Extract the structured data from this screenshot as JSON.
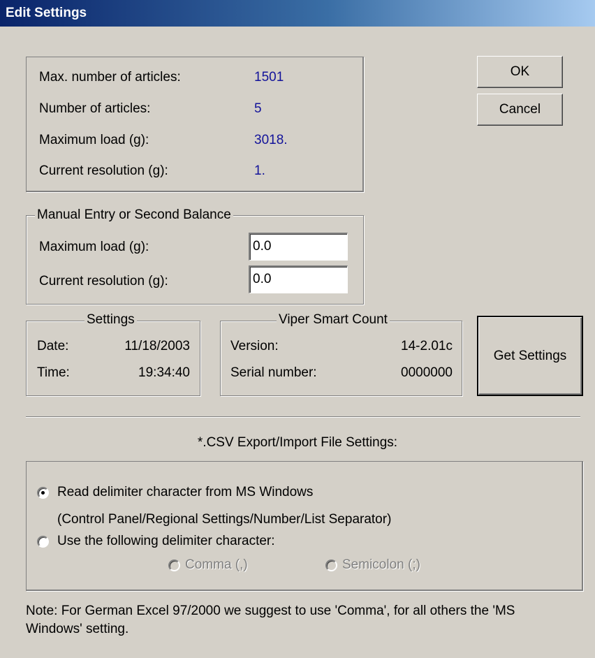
{
  "window": {
    "title": "Edit Settings"
  },
  "buttons": {
    "ok": "OK",
    "cancel": "Cancel",
    "get_settings": "Get Settings"
  },
  "info": {
    "max_articles_label": "Max. number of articles:",
    "max_articles_value": "1501",
    "num_articles_label": "Number of articles:",
    "num_articles_value": "5",
    "max_load_label": "Maximum load (g):",
    "max_load_value": "3018.",
    "resolution_label": "Current resolution (g):",
    "resolution_value": "1."
  },
  "manual": {
    "legend": "Manual Entry or Second Balance",
    "max_load_label": "Maximum load (g):",
    "max_load_value": "0.0",
    "resolution_label": "Current resolution (g):",
    "resolution_value": "0.0"
  },
  "settings": {
    "legend": "Settings",
    "date_label": "Date:",
    "date_value": "11/18/2003",
    "time_label": "Time:",
    "time_value": "19:34:40"
  },
  "viper": {
    "legend": "Viper Smart Count",
    "version_label": "Version:",
    "version_value": "14-2.01c",
    "serial_label": "Serial number:",
    "serial_value": "0000000"
  },
  "csv": {
    "heading": "*.CSV Export/Import File Settings:",
    "option_windows_line1": "Read delimiter character from MS Windows",
    "option_windows_line2": "(Control Panel/Regional Settings/Number/List Separator)",
    "option_windows_checked": true,
    "option_custom": "Use the following delimiter character:",
    "option_custom_checked": false,
    "comma": "Comma (,)",
    "semicolon": "Semicolon (;)"
  },
  "note": {
    "line1": "Note: For German Excel 97/2000 we suggest to use 'Comma', for all others the 'MS",
    "line2": "Windows' setting."
  }
}
